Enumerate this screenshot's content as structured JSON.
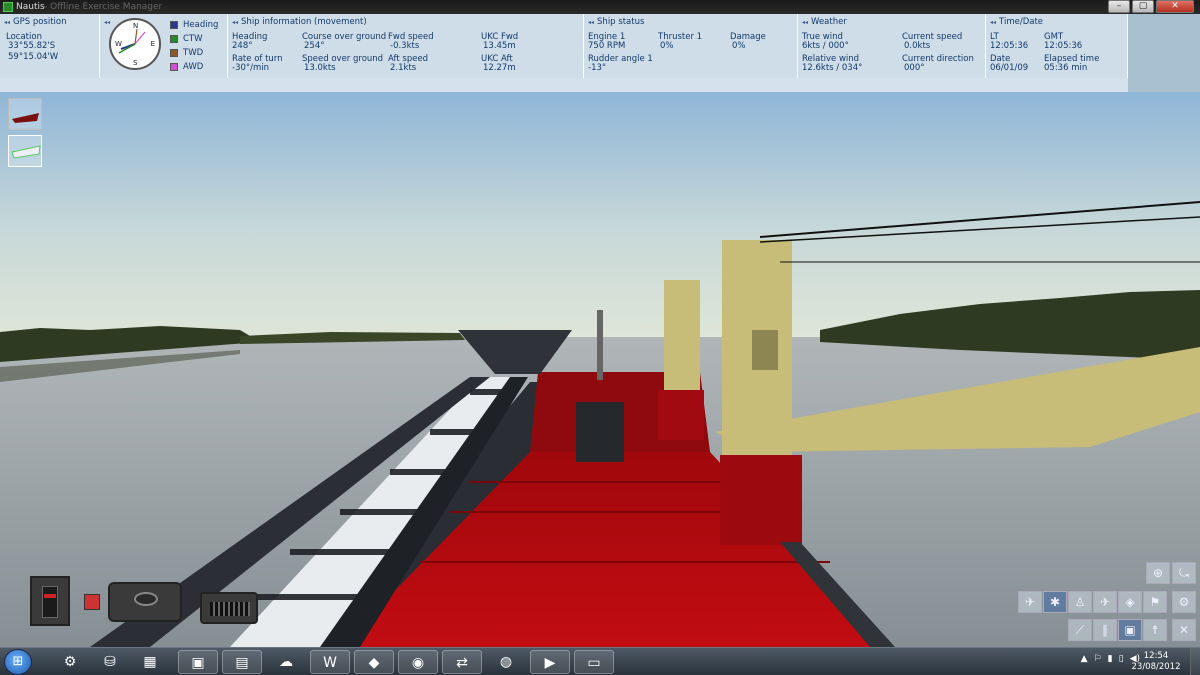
{
  "window": {
    "title": "Nautis",
    "subtitle": "- Offline Exercise Manager",
    "controls": [
      "–",
      "▢",
      "✕"
    ]
  },
  "gps": {
    "heading": "GPS position",
    "location_label": "Location",
    "lat": "33°55.82'S",
    "lon": "59°15.04'W"
  },
  "compass": {
    "n": "N",
    "s": "S",
    "e": "E",
    "w": "W",
    "legend": [
      {
        "label": "Heading",
        "color": "#2a3a8a"
      },
      {
        "label": "CTW",
        "color": "#2a8a2a"
      },
      {
        "label": "TWD",
        "color": "#8a5a2a"
      },
      {
        "label": "AWD",
        "color": "#d050d0"
      }
    ]
  },
  "movement": {
    "heading": "Ship information (movement)",
    "fields": [
      {
        "label": "Heading",
        "value": "248°"
      },
      {
        "label": "Course over ground",
        "value": "254°"
      },
      {
        "label": "Fwd speed",
        "value": "-0.3kts"
      },
      {
        "label": "UKC Fwd",
        "value": "13.45m"
      },
      {
        "label": "Rate of turn",
        "value": "-30°/min"
      },
      {
        "label": "Speed over ground",
        "value": "13.0kts"
      },
      {
        "label": "Aft speed",
        "value": "2.1kts"
      },
      {
        "label": "UKC Aft",
        "value": "12.27m"
      }
    ]
  },
  "status": {
    "heading": "Ship status",
    "fields": [
      {
        "label": "Engine 1",
        "value": "750 RPM"
      },
      {
        "label": "Thruster 1",
        "value": "0%"
      },
      {
        "label": "Damage",
        "value": "0%"
      },
      {
        "label": "Rudder angle 1",
        "value": "-13°"
      }
    ]
  },
  "weather": {
    "heading": "Weather",
    "fields": [
      {
        "label": "True wind",
        "value": "6kts / 000°"
      },
      {
        "label": "Current speed",
        "value": "0.0kts"
      },
      {
        "label": "Relative wind",
        "value": "12.6kts / 034°"
      },
      {
        "label": "Current direction",
        "value": "000°"
      }
    ]
  },
  "time": {
    "heading": "Time/Date",
    "fields": [
      {
        "label": "LT",
        "value": "12:05:36"
      },
      {
        "label": "GMT",
        "value": "12:05:36"
      },
      {
        "label": "Date",
        "value": "06/01/09"
      },
      {
        "label": "Elapsed time",
        "value": "05:36 min"
      }
    ]
  },
  "tools": [
    "⊕",
    "⤿",
    "✈",
    "✱",
    "♙",
    "✈",
    "◈",
    "⚑",
    "⚙",
    "⟋",
    "∥",
    "▣",
    "☨",
    "✕"
  ],
  "taskbar": {
    "start": "⊞",
    "apps": [
      "⚙",
      "⛁",
      "▦",
      "▣",
      "▤",
      "☁",
      "W",
      "◆",
      "◉",
      "⇄",
      "◍",
      "▶",
      "▭"
    ],
    "tray": [
      "▲",
      "⚐",
      "▮",
      "▯",
      "◀)"
    ],
    "time": "12:54",
    "date": "23/08/2012"
  },
  "colors": {
    "deck": "#b80a10",
    "crane": "#c8bd78",
    "water": "#9aa3a8",
    "sky_top": "#8fb6d8",
    "trees": "#2e3a22"
  }
}
